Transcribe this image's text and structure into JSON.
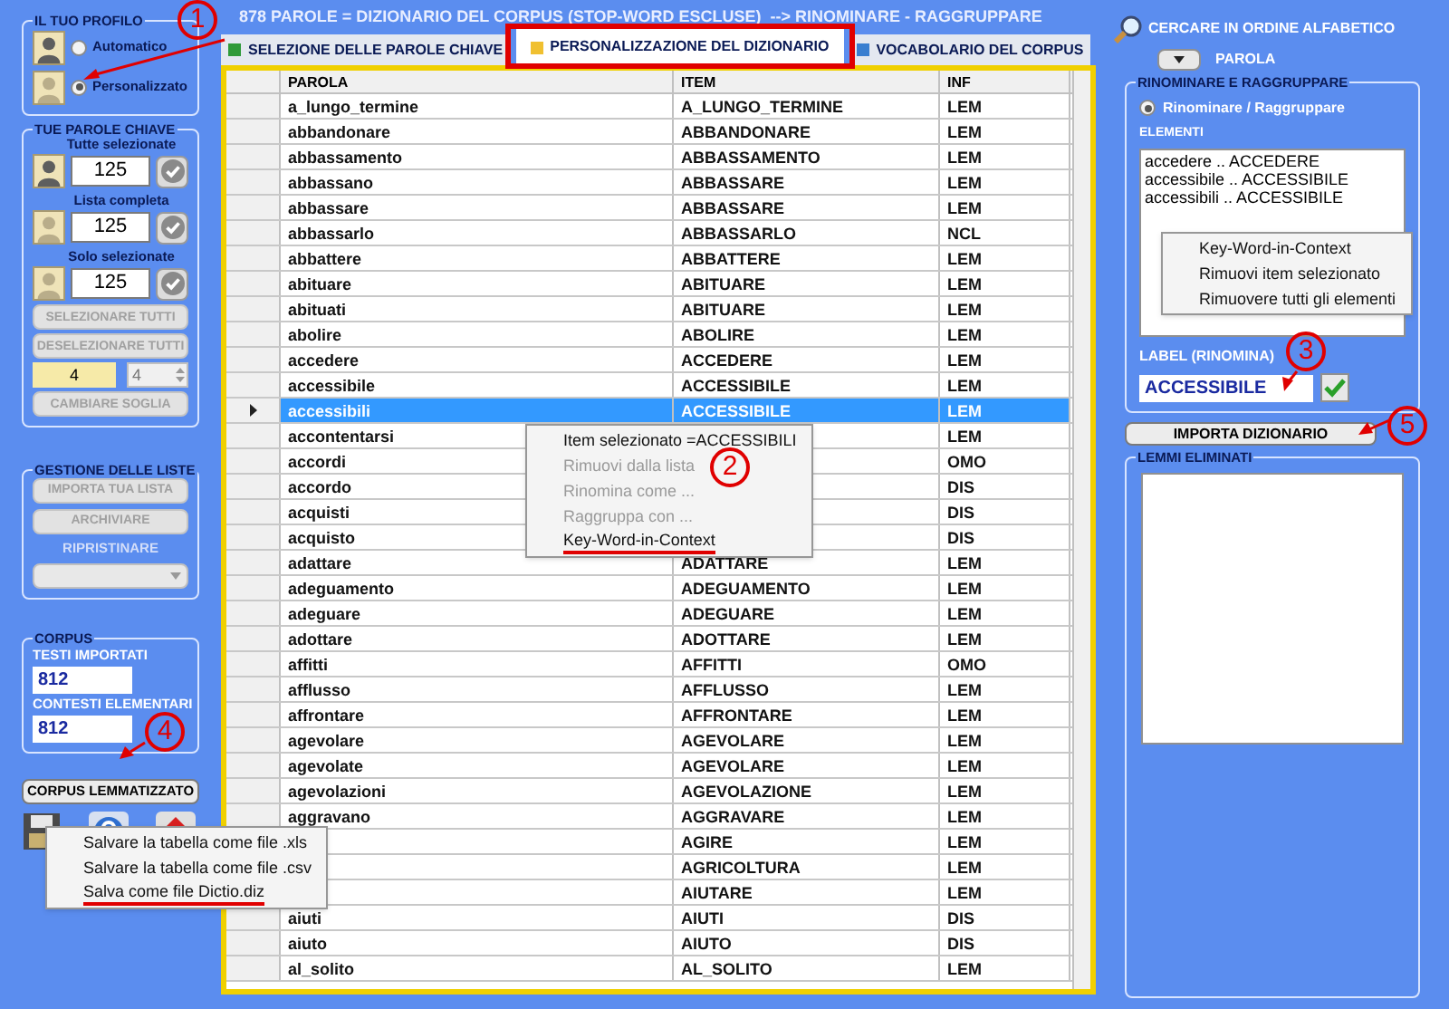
{
  "window": {
    "title": "878 PAROLE = DIZIONARIO DEL CORPUS (STOP-WORD ESCLUSE)  --> RINOMINARE - RAGGRUPPARE"
  },
  "profile": {
    "title": "IL TUO PROFILO",
    "options": [
      {
        "label": "Automatico",
        "selected": false
      },
      {
        "label": "Personalizzato",
        "selected": true
      }
    ]
  },
  "keywords": {
    "title": "TUE PAROLE CHIAVE",
    "counters": [
      {
        "label": "Tutte selezionate",
        "value": "125"
      },
      {
        "label": "Lista completa",
        "value": "125"
      },
      {
        "label": "Solo selezionate",
        "value": "125"
      }
    ],
    "buttons": [
      {
        "label": "SELEZIONARE TUTTI",
        "disabled": true
      },
      {
        "label": "DESELEZIONARE TUTTI",
        "disabled": true
      }
    ],
    "threshold": {
      "value": "4",
      "spin_value": "4"
    },
    "threshold_button": {
      "label": "CAMBIARE SOGLIA",
      "disabled": true
    }
  },
  "lists": {
    "title": "GESTIONE DELLE LISTE",
    "buttons": [
      {
        "label": "IMPORTA TUA LISTA",
        "disabled": true
      },
      {
        "label": "ARCHIVIARE",
        "disabled": true
      }
    ],
    "restore": {
      "label": "RIPRISTINARE",
      "disabled": true
    }
  },
  "corpus": {
    "title": "CORPUS",
    "fields": [
      {
        "label": "TESTI IMPORTATI",
        "value": "812"
      },
      {
        "label": "CONTESTI ELEMENTARI",
        "value": "812"
      }
    ]
  },
  "corpus_button": "CORPUS LEMMATIZZATO",
  "save_menu": [
    {
      "label": "Salvare la tabella come file .xls",
      "underlined": false
    },
    {
      "label": "Salvare la tabella come file .csv",
      "underlined": false
    },
    {
      "label": "Salva come file Dictio.diz",
      "underlined": true
    }
  ],
  "tabs": [
    {
      "label": "SELEZIONE DELLE PAROLE CHIAVE",
      "selected": false,
      "color": "#2f9a3a"
    },
    {
      "label": "PERSONALIZZAZIONE DEL DIZIONARIO",
      "selected": true,
      "color": "#f0c030"
    },
    {
      "label": "VOCABOLARIO DEL CORPUS",
      "selected": false,
      "color": "#3a7fd0"
    }
  ],
  "table": {
    "columns": [
      "PAROLA",
      "ITEM",
      "INF"
    ],
    "rows": [
      {
        "parola": "a_lungo_termine",
        "item": "A_LUNGO_TERMINE",
        "inf": "LEM",
        "selected": false
      },
      {
        "parola": "abbandonare",
        "item": "ABBANDONARE",
        "inf": "LEM",
        "selected": false
      },
      {
        "parola": "abbassamento",
        "item": "ABBASSAMENTO",
        "inf": "LEM",
        "selected": false
      },
      {
        "parola": "abbassano",
        "item": "ABBASSARE",
        "inf": "LEM",
        "selected": false
      },
      {
        "parola": "abbassare",
        "item": "ABBASSARE",
        "inf": "LEM",
        "selected": false
      },
      {
        "parola": "abbassarlo",
        "item": "ABBASSARLO",
        "inf": "NCL",
        "selected": false
      },
      {
        "parola": "abbattere",
        "item": "ABBATTERE",
        "inf": "LEM",
        "selected": false
      },
      {
        "parola": "abituare",
        "item": "ABITUARE",
        "inf": "LEM",
        "selected": false
      },
      {
        "parola": "abituati",
        "item": "ABITUARE",
        "inf": "LEM",
        "selected": false
      },
      {
        "parola": "abolire",
        "item": "ABOLIRE",
        "inf": "LEM",
        "selected": false
      },
      {
        "parola": "accedere",
        "item": "ACCEDERE",
        "inf": "LEM",
        "selected": false
      },
      {
        "parola": "accessibile",
        "item": "ACCESSIBILE",
        "inf": "LEM",
        "selected": false
      },
      {
        "parola": "accessibili",
        "item": "ACCESSIBILE",
        "inf": "LEM",
        "selected": true
      },
      {
        "parola": "accontentarsi",
        "inf": "LEM",
        "selected": false
      },
      {
        "parola": "accordi",
        "inf": "OMO",
        "selected": false
      },
      {
        "parola": "accordo",
        "inf": "DIS",
        "selected": false
      },
      {
        "parola": "acquisti",
        "inf": "DIS",
        "selected": false
      },
      {
        "parola": "acquisto",
        "inf": "DIS",
        "selected": false
      },
      {
        "parola": "adattare",
        "item": "ADATTARE",
        "inf": "LEM",
        "selected": false
      },
      {
        "parola": "adeguamento",
        "item": "ADEGUAMENTO",
        "inf": "LEM",
        "selected": false
      },
      {
        "parola": "adeguare",
        "item": "ADEGUARE",
        "inf": "LEM",
        "selected": false
      },
      {
        "parola": "adottare",
        "item": "ADOTTARE",
        "inf": "LEM",
        "selected": false
      },
      {
        "parola": "affitti",
        "item": "AFFITTI",
        "inf": "OMO",
        "selected": false
      },
      {
        "parola": "afflusso",
        "item": "AFFLUSSO",
        "inf": "LEM",
        "selected": false
      },
      {
        "parola": "affrontare",
        "item": "AFFRONTARE",
        "inf": "LEM",
        "selected": false
      },
      {
        "parola": "agevolare",
        "item": "AGEVOLARE",
        "inf": "LEM",
        "selected": false
      },
      {
        "parola": "agevolate",
        "item": "AGEVOLARE",
        "inf": "LEM",
        "selected": false
      },
      {
        "parola": "agevolazioni",
        "item": "AGEVOLAZIONE",
        "inf": "LEM",
        "selected": false
      },
      {
        "parola": "aggravano",
        "item": "AGGRAVARE",
        "inf": "LEM",
        "selected": false
      },
      {
        "item": "AGIRE",
        "inf": "LEM",
        "selected": false
      },
      {
        "item": "AGRICOLTURA",
        "inf": "LEM",
        "selected": false
      },
      {
        "item": "AIUTARE",
        "inf": "LEM",
        "selected": false
      },
      {
        "parola": "aiuti",
        "item": "AIUTI",
        "inf": "DIS",
        "selected": false
      },
      {
        "parola": "aiuto",
        "item": "AIUTO",
        "inf": "DIS",
        "selected": false
      },
      {
        "parola": "al_solito",
        "item": "AL_SOLITO",
        "inf": "LEM",
        "selected": false
      }
    ]
  },
  "row_menu": [
    {
      "label": "Item selezionato =ACCESSIBILI",
      "disabled": false,
      "underlined": false
    },
    {
      "label": "Rimuovi dalla lista",
      "disabled": true,
      "underlined": false
    },
    {
      "label": "Rinomina come ...",
      "disabled": true,
      "underlined": false
    },
    {
      "label": "Raggruppa con ...",
      "disabled": true,
      "underlined": false
    },
    {
      "label": "Key-Word-in-Context",
      "disabled": false,
      "underlined": true
    }
  ],
  "search": {
    "title": "CERCARE IN ORDINE ALFABETICO",
    "field_label": "PAROLA"
  },
  "rename": {
    "title": "RINOMINARE E RAGGRUPPARE",
    "mode": {
      "label": "Rinominare / Raggruppare",
      "selected": true
    },
    "elements_label": "ELEMENTI",
    "elements": [
      "accedere .. ACCEDERE",
      "accessibile .. ACCESSIBILE",
      "accessibili .. ACCESSIBILE"
    ],
    "menu": [
      "Key-Word-in-Context",
      "Rimuovi item selezionato",
      "Rimuovere tutti gli elementi"
    ],
    "label_caption": "LABEL (RINOMINA)",
    "label_value": "ACCESSIBILE"
  },
  "import_button": "IMPORTA DIZIONARIO",
  "removed": {
    "title": "LEMMI ELIMINATI"
  },
  "annotations": [
    {
      "number": "1"
    },
    {
      "number": "2"
    },
    {
      "number": "3"
    },
    {
      "number": "4"
    },
    {
      "number": "5"
    }
  ]
}
